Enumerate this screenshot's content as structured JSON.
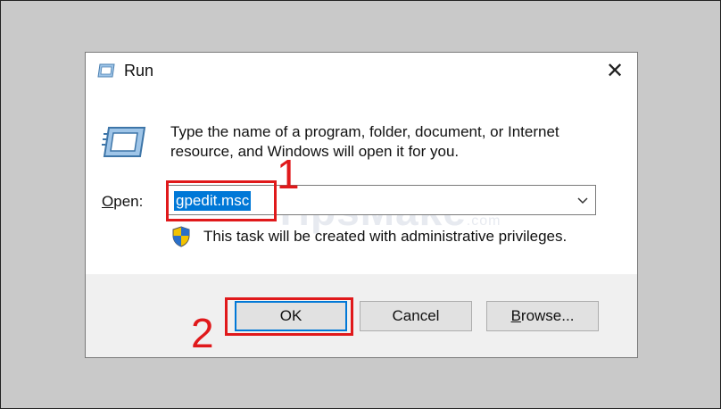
{
  "window": {
    "title": "Run",
    "close_glyph": "✕"
  },
  "description": "Type the name of a program, folder, document, or Internet resource, and Windows will open it for you.",
  "open": {
    "label_prefix": "O",
    "label_rest": "pen:",
    "value": "gpedit.msc"
  },
  "admin_note": "This task will be created with administrative privileges.",
  "buttons": {
    "ok": "OK",
    "cancel": "Cancel",
    "browse_prefix": "B",
    "browse_rest": "rowse..."
  },
  "annotations": {
    "step1": "1",
    "step2": "2",
    "color": "#e0191b"
  },
  "watermark": {
    "main": "TipsMake",
    "suffix": ".com"
  },
  "colors": {
    "accent": "#0078d7",
    "footer": "#f0f0f0",
    "button": "#e1e1e1"
  }
}
